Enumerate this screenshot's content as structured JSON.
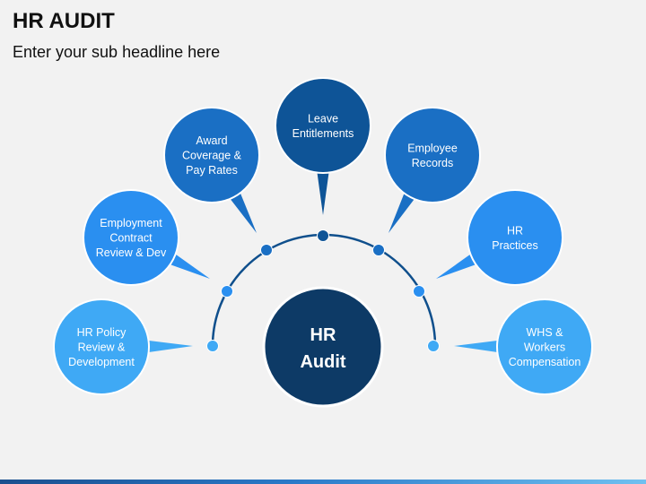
{
  "header": {
    "title": "HR AUDIT",
    "subtitle": "Enter your sub headline here"
  },
  "center": {
    "lines": [
      "HR",
      "Audit"
    ],
    "color": "#0d3a66"
  },
  "arc_color": "#0f4f8c",
  "nodes": [
    {
      "id": "hr-policy",
      "lines": [
        "HR Policy",
        "Review &",
        "Development"
      ],
      "color": "#3fa9f5"
    },
    {
      "id": "employment-contract",
      "lines": [
        "Employment",
        "Contract",
        "Review & Dev"
      ],
      "color": "#2a8ff0"
    },
    {
      "id": "award-coverage",
      "lines": [
        "Award",
        "Coverage &",
        "Pay Rates"
      ],
      "color": "#1a6fc4"
    },
    {
      "id": "leave-entitlements",
      "lines": [
        "Leave",
        "Entitlements"
      ],
      "color": "#0e5497"
    },
    {
      "id": "employee-records",
      "lines": [
        "Employee",
        "Records"
      ],
      "color": "#1a6fc4"
    },
    {
      "id": "hr-practices",
      "lines": [
        "HR",
        "Practices"
      ],
      "color": "#2a8ff0"
    },
    {
      "id": "whs-workers-comp",
      "lines": [
        "WHS &",
        "Workers",
        "Compensation"
      ],
      "color": "#3fa9f5"
    }
  ]
}
